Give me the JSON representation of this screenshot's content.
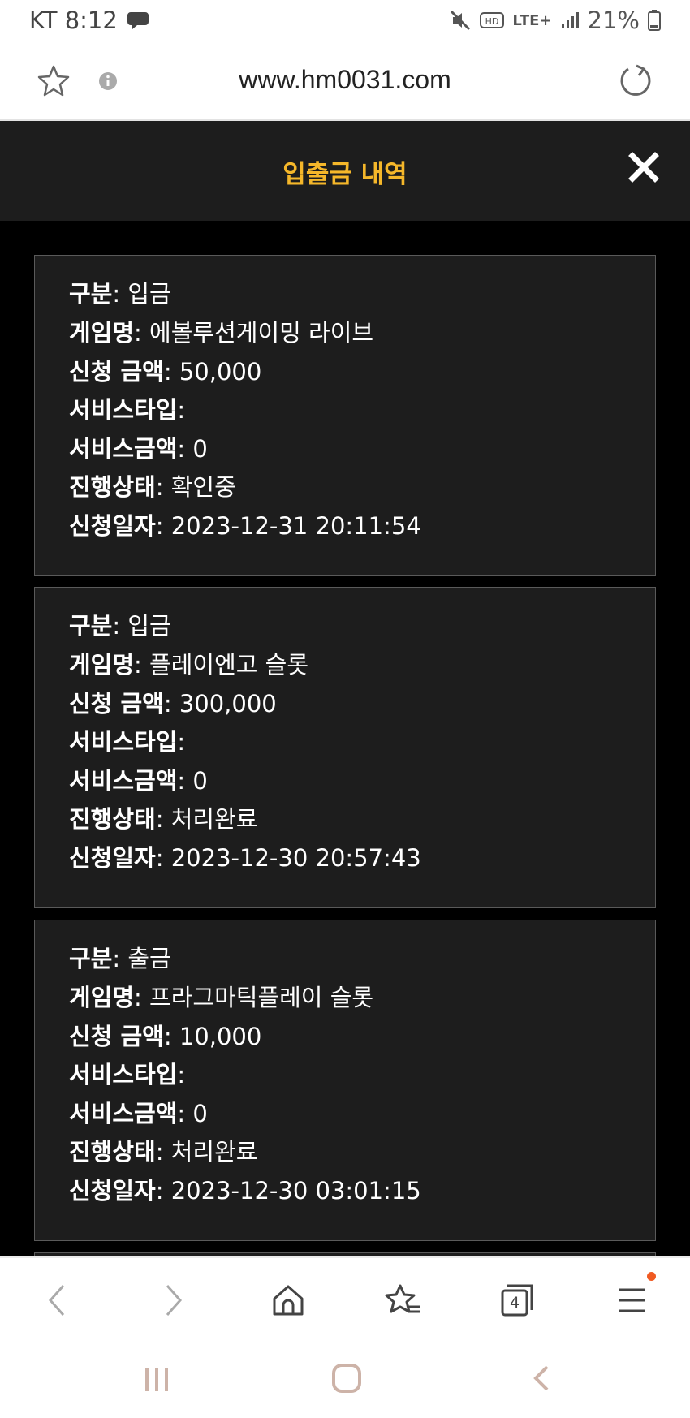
{
  "status_bar": {
    "carrier_time": "KT 8:12",
    "battery": "21%",
    "network": "LTE+"
  },
  "url_bar": {
    "url": "www.hm0031.com"
  },
  "modal": {
    "title": "입출금 내역"
  },
  "labels": {
    "type": "구분",
    "game": "게임명",
    "amount": "신청 금액",
    "service_type": "서비스타입",
    "service_amount": "서비스금액",
    "status": "진행상태",
    "date": "신청일자"
  },
  "records": [
    {
      "type": "입금",
      "game": "에볼루션게이밍 라이브",
      "amount": "50,000",
      "service_type": "",
      "service_amount": "0",
      "status": "확인중",
      "date": "2023-12-31 20:11:54"
    },
    {
      "type": "입금",
      "game": "플레이엔고 슬롯",
      "amount": "300,000",
      "service_type": "",
      "service_amount": "0",
      "status": "처리완료",
      "date": "2023-12-30 20:57:43"
    },
    {
      "type": "출금",
      "game": "프라그마틱플레이 슬롯",
      "amount": "10,000",
      "service_type": "",
      "service_amount": "0",
      "status": "처리완료",
      "date": "2023-12-30 03:01:15"
    }
  ],
  "browser_nav": {
    "tab_count": "4"
  },
  "colors": {
    "accent": "#f5b72a",
    "card_bg": "#1d1d1d",
    "badge": "#f05a22"
  }
}
